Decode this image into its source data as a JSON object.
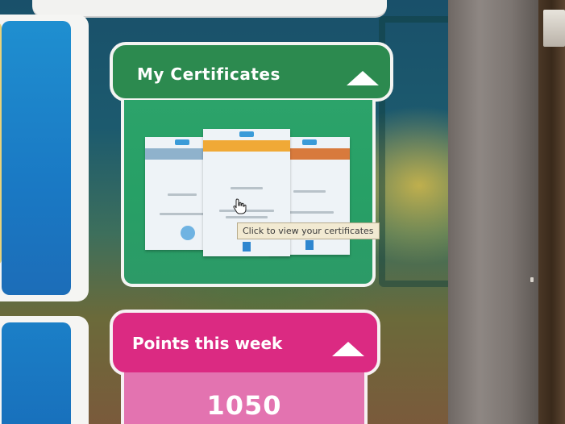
{
  "certificates_widget": {
    "title": "My Certificates",
    "tooltip": "Click to view your certificates",
    "accent": "#2c8a4f"
  },
  "points_widget": {
    "title": "Points this week",
    "value": "1050",
    "accent": "#db2a82"
  },
  "icons": {
    "collapse": "caret-up-icon",
    "pointer": "hand-cursor-icon"
  }
}
